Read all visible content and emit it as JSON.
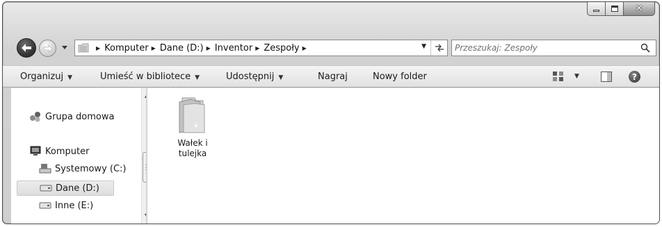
{
  "address": {
    "breadcrumbs": [
      {
        "label": "Komputer"
      },
      {
        "label": "Dane (D:)"
      },
      {
        "label": "Inventor"
      },
      {
        "label": "Zespoły"
      }
    ]
  },
  "search": {
    "placeholder": "Przeszukaj: Zespoły"
  },
  "toolbar": {
    "organize_label": "Organizuj",
    "library_label": "Umieść w bibliotece",
    "share_label": "Udostępnij",
    "burn_label": "Nagraj",
    "new_folder_label": "Nowy folder"
  },
  "nav_pane": {
    "homegroup_label": "Grupa domowa",
    "computer_label": "Komputer",
    "drives": [
      {
        "label": "Systemowy (C:)"
      },
      {
        "label": "Dane (D:)"
      },
      {
        "label": "Inne (E:)"
      }
    ]
  },
  "content": {
    "items": [
      {
        "line1": "Wałek i",
        "line2": "tulejka"
      }
    ]
  }
}
